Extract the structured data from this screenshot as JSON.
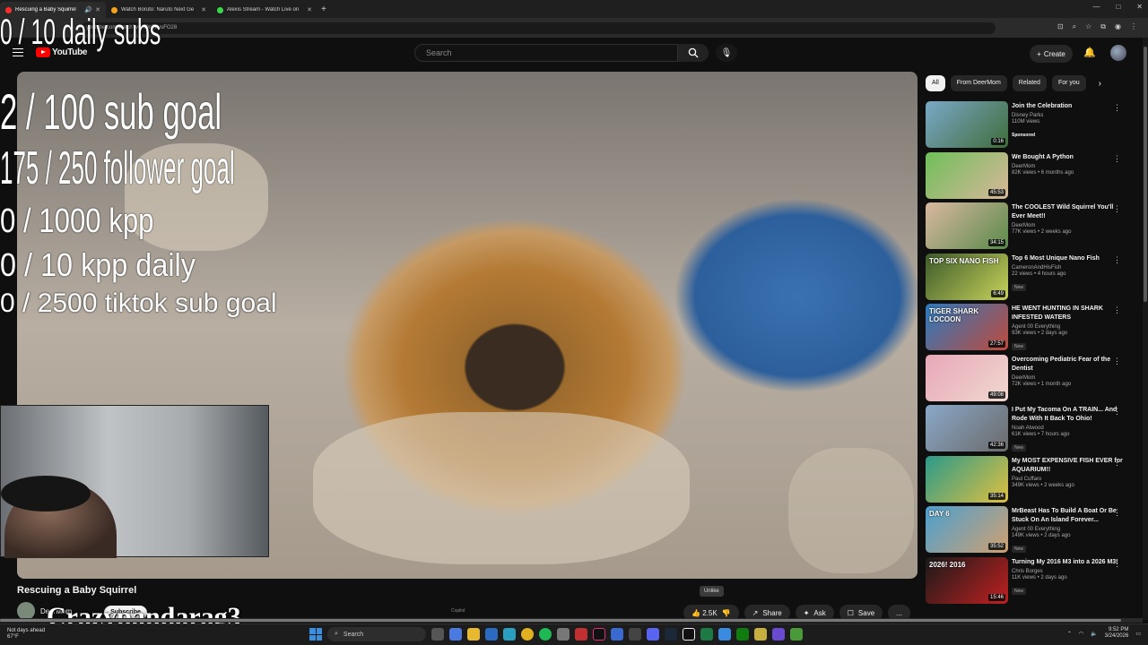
{
  "browser": {
    "tabs": [
      {
        "title": "Rescuing a Baby Squirrel",
        "color": "#ff2d2d",
        "active": true
      },
      {
        "title": "Watch Boruto: Naruto Next Ge",
        "color": "#f4a21c",
        "active": false
      },
      {
        "title": "Alexis Stream - Watch Live on",
        "color": "#3ad84c",
        "active": false
      }
    ],
    "new_tab": "+",
    "url": "youtube.com/watch?v=...0nTkyuFO28",
    "window_controls": [
      "—",
      "□",
      "✕"
    ]
  },
  "youtube": {
    "logo": "YouTube",
    "search_placeholder": "Search",
    "create_label": "Create"
  },
  "stream_overlay": {
    "daily_subs": "0 / 10 daily subs",
    "sub_goal": "2  / 100 sub goal",
    "follower_goal": "175 / 250 follower goal",
    "kpp": "0 / 1000 kpp",
    "kpp_daily": "0 / 10 kpp daily",
    "tiktok_goal": "0 / 2500 tiktok sub goal",
    "watermark": "Crazypandarag3"
  },
  "video": {
    "title": "Rescuing a Baby Squirrel",
    "channel": "DeerMom",
    "subscribe_label": "Subscribe",
    "like_count": "2.5K",
    "tooltip": "Unlike",
    "share_label": "Share",
    "ask_label": "Ask",
    "save_label": "Save",
    "more_label": "...",
    "copilot_hint": "Copilot"
  },
  "chips": [
    "All",
    "From DeerMom",
    "Related",
    "For you"
  ],
  "recommendations": [
    {
      "title": "Join the Celebration",
      "channel": "Disney Parks",
      "meta": "110M views",
      "badge": "Sponsored",
      "duration": "0:16",
      "colors": [
        "#7aa8c8",
        "#3f6d3a"
      ]
    },
    {
      "title": "We Bought A Python",
      "channel": "DeerMom",
      "meta": "82K views • 6 months ago",
      "badge": "",
      "duration": "45:53",
      "colors": [
        "#6fbf5a",
        "#d8b79a"
      ]
    },
    {
      "title": "The COOLEST Wild Squirrel You'll Ever Meet!!",
      "channel": "DeerMom",
      "meta": "77K views • 2 weeks ago",
      "badge": "",
      "duration": "34:15",
      "colors": [
        "#d9b8a0",
        "#5a8a4a"
      ]
    },
    {
      "title": "Top 6 Most Unique Nano Fish",
      "channel": "CameronAndHisFish",
      "meta": "22 views • 4 hours ago",
      "badge": "New",
      "duration": "6:49",
      "colors": [
        "#3c5a2a",
        "#c8d25a"
      ]
    },
    {
      "title": "HE WENT HUNTING IN SHARK INFESTED WATERS",
      "channel": "Agent 00 Everything",
      "meta": "93K views • 2 days ago",
      "badge": "New",
      "duration": "27:57",
      "colors": [
        "#2a7ac0",
        "#c04a3a"
      ]
    },
    {
      "title": "Overcoming Pediatric Fear of the Dentist",
      "channel": "DeerMom",
      "meta": "72K views • 1 month ago",
      "badge": "",
      "duration": "49:08",
      "colors": [
        "#e8a8b8",
        "#f0d8d0"
      ]
    },
    {
      "title": "I Put My Tacoma On A TRAIN... And Rode With It Back To Ohio!",
      "channel": "Noah Atwood",
      "meta": "61K views • 7 hours ago",
      "badge": "New",
      "duration": "42:36",
      "colors": [
        "#8aa8c8",
        "#6a6a6a"
      ]
    },
    {
      "title": "My MOST EXPENSIVE FISH EVER for AQUARIUM!!",
      "channel": "Paul Cuffaro",
      "meta": "349K views • 2 weeks ago",
      "badge": "",
      "duration": "35:14",
      "colors": [
        "#2a9a8a",
        "#e0c040"
      ]
    },
    {
      "title": "MrBeast Has To Build A Boat Or Be Stuck On An Island Forever...",
      "channel": "Agent 00 Everything",
      "meta": "149K views • 2 days ago",
      "badge": "New",
      "duration": "35:52",
      "colors": [
        "#4aa0d0",
        "#d0a070"
      ]
    },
    {
      "title": "Turning My 2016 M3 into a 2026 M3!",
      "channel": "Chris Borges",
      "meta": "11K views • 2 days ago",
      "badge": "New",
      "duration": "15:46",
      "colors": [
        "#1a1a1a",
        "#c02020"
      ]
    }
  ],
  "rec_thumb_text": {
    "nano": "TOP SIX NANO FISH",
    "shark": "TIGER SHARK LOCOON",
    "day": "DAY 6",
    "year": "2026!  2016"
  },
  "taskbar": {
    "weather_line1": "Not days ahead",
    "weather_line2": "67°F",
    "search_label": "Search",
    "time": "9:52 PM",
    "date": "3/24/2026"
  }
}
